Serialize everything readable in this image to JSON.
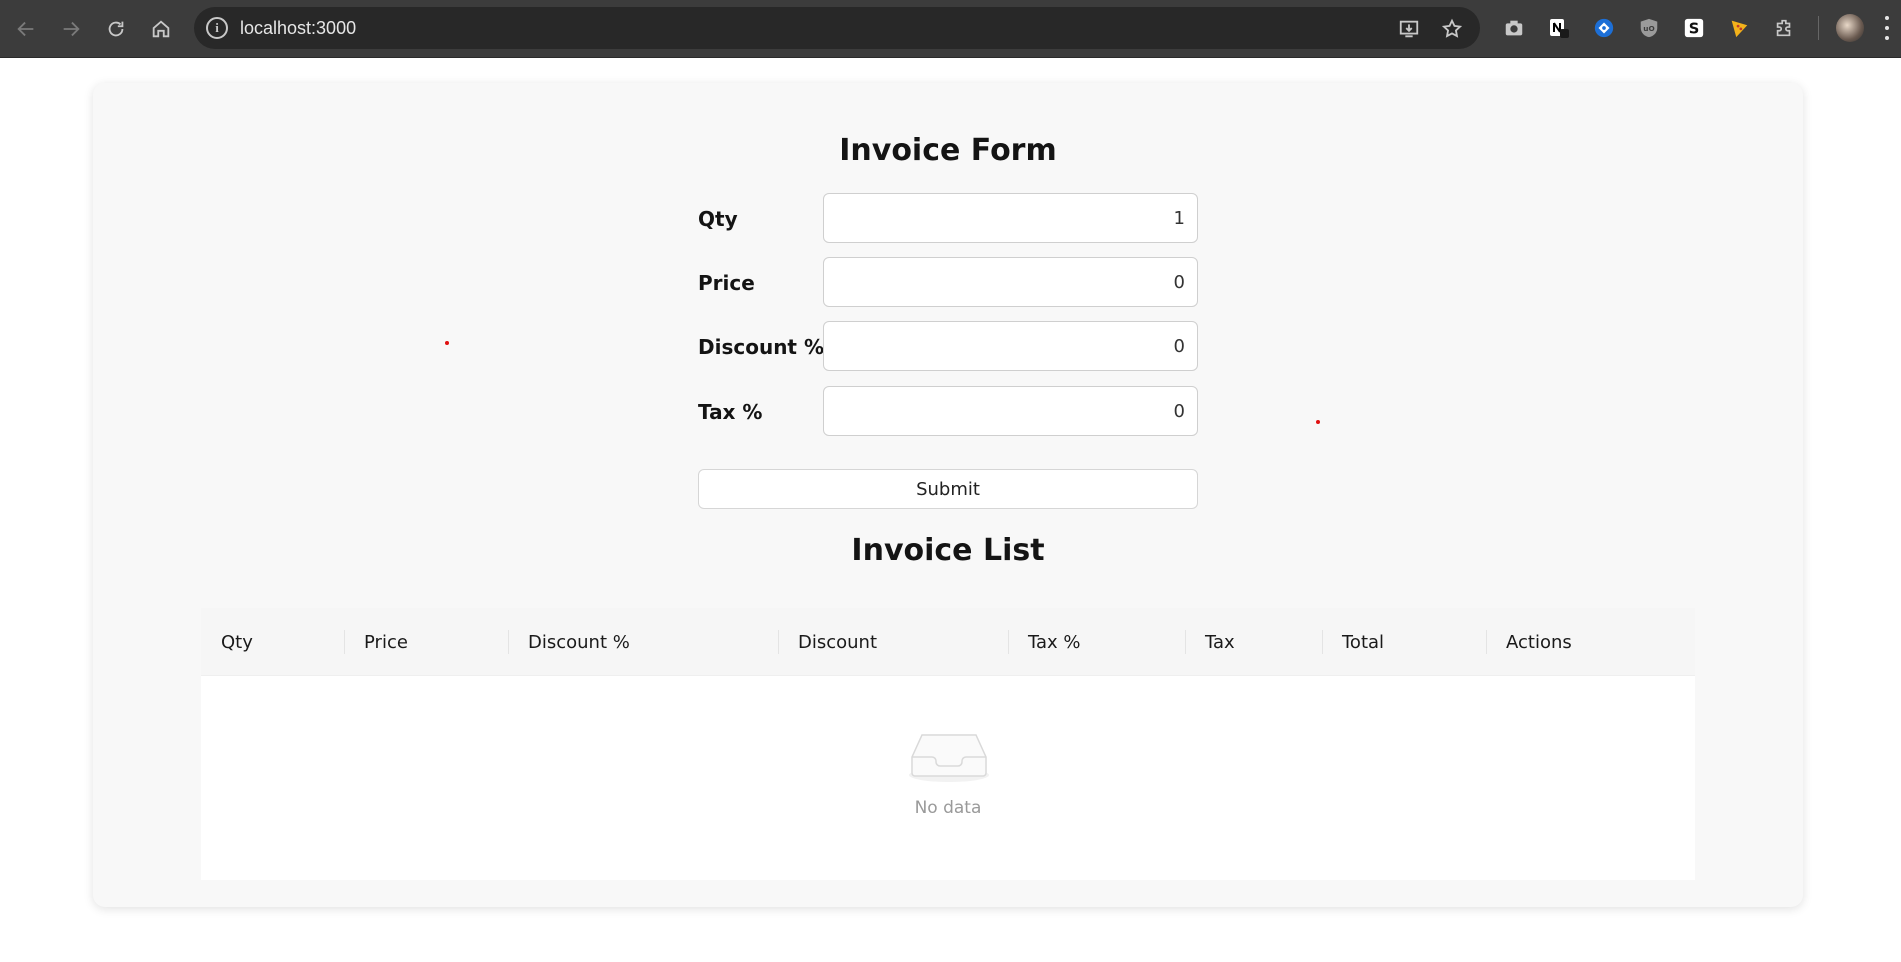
{
  "browser": {
    "url": "localhost:3000"
  },
  "form": {
    "title": "Invoice Form",
    "fields": [
      {
        "label": "Qty",
        "value": "1"
      },
      {
        "label": "Price",
        "value": "0"
      },
      {
        "label": "Discount %",
        "value": "0"
      },
      {
        "label": "Tax %",
        "value": "0"
      }
    ],
    "submit_label": "Submit"
  },
  "list": {
    "title": "Invoice List",
    "columns": [
      "Qty",
      "Price",
      "Discount %",
      "Discount",
      "Tax %",
      "Tax",
      "Total",
      "Actions"
    ],
    "empty_text": "No data"
  },
  "colors": {
    "accent_dot": "#e01010",
    "card_bg": "#f8f8f8"
  }
}
